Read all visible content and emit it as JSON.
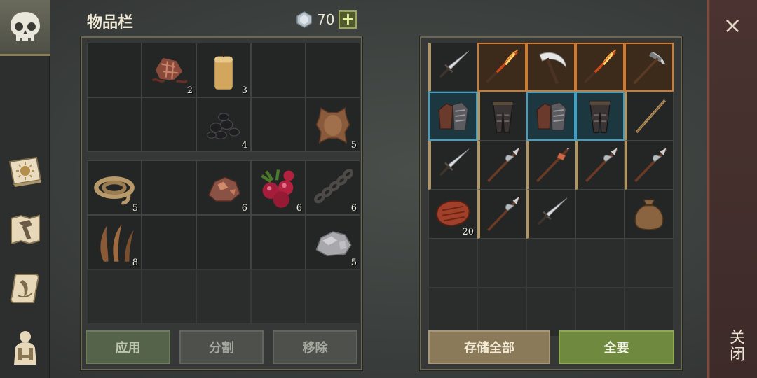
{
  "header": {
    "title": "物品栏",
    "currency_value": "70",
    "add_label": "+"
  },
  "close": {
    "x_label": "×",
    "label": "关闭"
  },
  "side_nav": [
    {
      "icon": "skull-icon",
      "active": true
    },
    {
      "icon": "sun-book-icon",
      "active": false
    },
    {
      "icon": "hammer-map-icon",
      "active": false
    },
    {
      "icon": "quest-scroll-icon",
      "active": false
    },
    {
      "icon": "character-icon",
      "active": false
    }
  ],
  "inventory": {
    "top_rows": [
      [
        {
          "icon": ""
        },
        {
          "icon": "leather-scraps-icon",
          "qty": "2"
        },
        {
          "icon": "candle-icon",
          "qty": "3"
        },
        {
          "icon": ""
        },
        {
          "icon": ""
        }
      ],
      [
        {
          "icon": ""
        },
        {
          "icon": ""
        },
        {
          "icon": "coal-icon",
          "qty": "4"
        },
        {
          "icon": ""
        },
        {
          "icon": "animal-hide-icon",
          "qty": "5"
        }
      ]
    ],
    "bottom_rows": [
      [
        {
          "icon": "rope-icon",
          "qty": "5"
        },
        {
          "icon": ""
        },
        {
          "icon": "copper-ore-icon",
          "qty": "6"
        },
        {
          "icon": "berries-icon",
          "qty": "6"
        },
        {
          "icon": "chain-icon",
          "qty": "6"
        }
      ],
      [
        {
          "icon": "plant-fiber-icon",
          "qty": "8"
        },
        {
          "icon": ""
        },
        {
          "icon": ""
        },
        {
          "icon": ""
        },
        {
          "icon": "stone-icon",
          "qty": "5"
        }
      ],
      [
        {
          "icon": ""
        },
        {
          "icon": ""
        },
        {
          "icon": ""
        },
        {
          "icon": ""
        },
        {
          "icon": ""
        }
      ]
    ]
  },
  "storage": {
    "rows": [
      [
        {
          "icon": "sword-icon",
          "rarity": "common"
        },
        {
          "icon": "flame-sword-icon",
          "rarity": "epic"
        },
        {
          "icon": "scythe-icon",
          "rarity": "epic"
        },
        {
          "icon": "flame-sword-icon",
          "rarity": "epic"
        },
        {
          "icon": "pickaxe-icon",
          "rarity": "epic"
        }
      ],
      [
        {
          "icon": "gauntlets-icon",
          "rarity": "rare"
        },
        {
          "icon": "leg-armor-icon",
          "rarity": "common"
        },
        {
          "icon": "gauntlets-icon",
          "rarity": "rare"
        },
        {
          "icon": "leg-armor-icon",
          "rarity": "rare"
        },
        {
          "icon": "staff-icon",
          "rarity": "common"
        }
      ],
      [
        {
          "icon": "sword-icon",
          "rarity": "common"
        },
        {
          "icon": "halberd-icon",
          "rarity": "common"
        },
        {
          "icon": "mace-spear-icon",
          "rarity": "common"
        },
        {
          "icon": "halberd-icon",
          "rarity": "common"
        },
        {
          "icon": "halberd-icon",
          "rarity": "common"
        }
      ],
      [
        {
          "icon": "steak-icon",
          "rarity": "none",
          "qty": "20"
        },
        {
          "icon": "halberd-icon",
          "rarity": "common"
        },
        {
          "icon": "sword-icon",
          "rarity": "common"
        },
        {
          "icon": "",
          "rarity": "none"
        },
        {
          "icon": "sack-icon",
          "rarity": "none"
        }
      ],
      [
        {
          "icon": ""
        },
        {
          "icon": ""
        },
        {
          "icon": ""
        },
        {
          "icon": ""
        },
        {
          "icon": ""
        }
      ],
      [
        {
          "icon": ""
        },
        {
          "icon": ""
        },
        {
          "icon": ""
        },
        {
          "icon": ""
        },
        {
          "icon": ""
        }
      ]
    ]
  },
  "buttons": {
    "apply": "应用",
    "split": "分割",
    "remove": "移除",
    "store_all": "存储全部",
    "take_all": "全要"
  },
  "colors": {
    "rare": "#3da0c6",
    "epic": "#d2792a",
    "common": "#b19563"
  }
}
